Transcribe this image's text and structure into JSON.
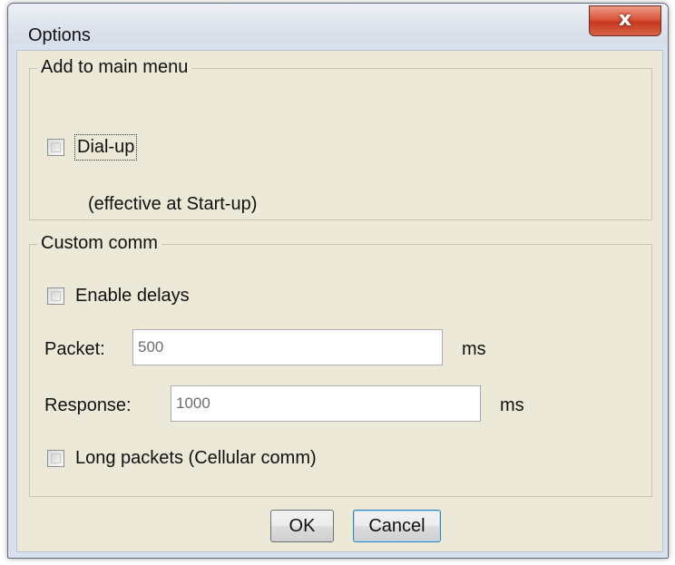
{
  "window": {
    "title": "Options",
    "close_label": "x"
  },
  "main_menu_group": {
    "title": "Add to main menu",
    "dialup": {
      "label": "Dial-up",
      "checked": false
    },
    "note": "(effective at Start-up)"
  },
  "custom_comm_group": {
    "title": "Custom comm",
    "enable_delays": {
      "label": "Enable delays",
      "checked": false
    },
    "packet": {
      "label": "Packet:",
      "value": "500",
      "unit": "ms"
    },
    "response": {
      "label": "Response:",
      "value": "1000",
      "unit": "ms"
    },
    "long_packets": {
      "label": "Long packets (Cellular comm)",
      "checked": false
    }
  },
  "buttons": {
    "ok": "OK",
    "cancel": "Cancel"
  }
}
